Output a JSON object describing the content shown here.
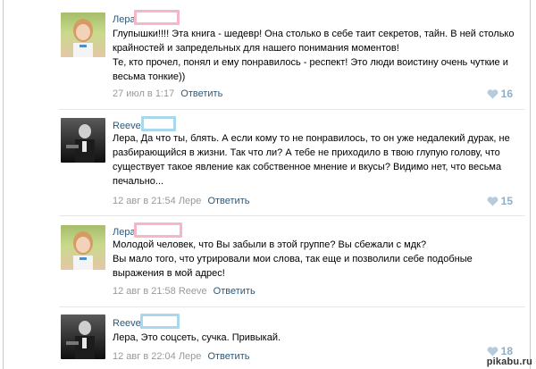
{
  "comments": [
    {
      "author": "Лера",
      "text": [
        "Глупышки!!!! Эта книга - шедевр! Она столько в себе таит секретов, тайн. В ней столько крайностей и запредельных для нашего понимания моментов!",
        "Те, кто прочел, понял и ему понравилось - респект! Это люди воистину очень чуткие и весьма тонкие))"
      ],
      "date": "27 июл в 1:17",
      "reply_to": "",
      "reply_label": "Ответить",
      "likes": "16"
    },
    {
      "author": "Reeve",
      "text": [
        "Лера, Да что ты, блять. А если кому то не понравилось, то он уже недалекий дурак, не разбирающийся в жизни. Так что ли? А тебе не приходило в твою глупую голову, что существует такое явление как собственное мнение и вкусы? Видимо нет, что весьма печально..."
      ],
      "date": "12 авг в 21:54",
      "reply_to": "Лере",
      "reply_label": "Ответить",
      "likes": "15"
    },
    {
      "author": "Лера",
      "text": [
        "Молодой человек, что Вы забыли в этой группе? Вы сбежали с мдк?",
        "Вы мало того, что утрировали мои слова, так еще и позволили себе подобные выражения в мой адрес!"
      ],
      "date": "12 авг в 21:58",
      "reply_to": "Reeve",
      "reply_label": "Ответить",
      "likes": ""
    },
    {
      "author": "Reeve",
      "text": [
        "Лера, Это соцсеть, сучка. Привыкай."
      ],
      "date": "12 авг в 22:04",
      "reply_to": "Лере",
      "reply_label": "Ответить",
      "likes": "18"
    }
  ],
  "watermark": "pikabu.ru",
  "colors": {
    "link": "#2b587a",
    "meta": "#999999",
    "likes": "#8faec7",
    "redact_pink": "#f7b6c8",
    "redact_blue": "#a9d8ec"
  }
}
